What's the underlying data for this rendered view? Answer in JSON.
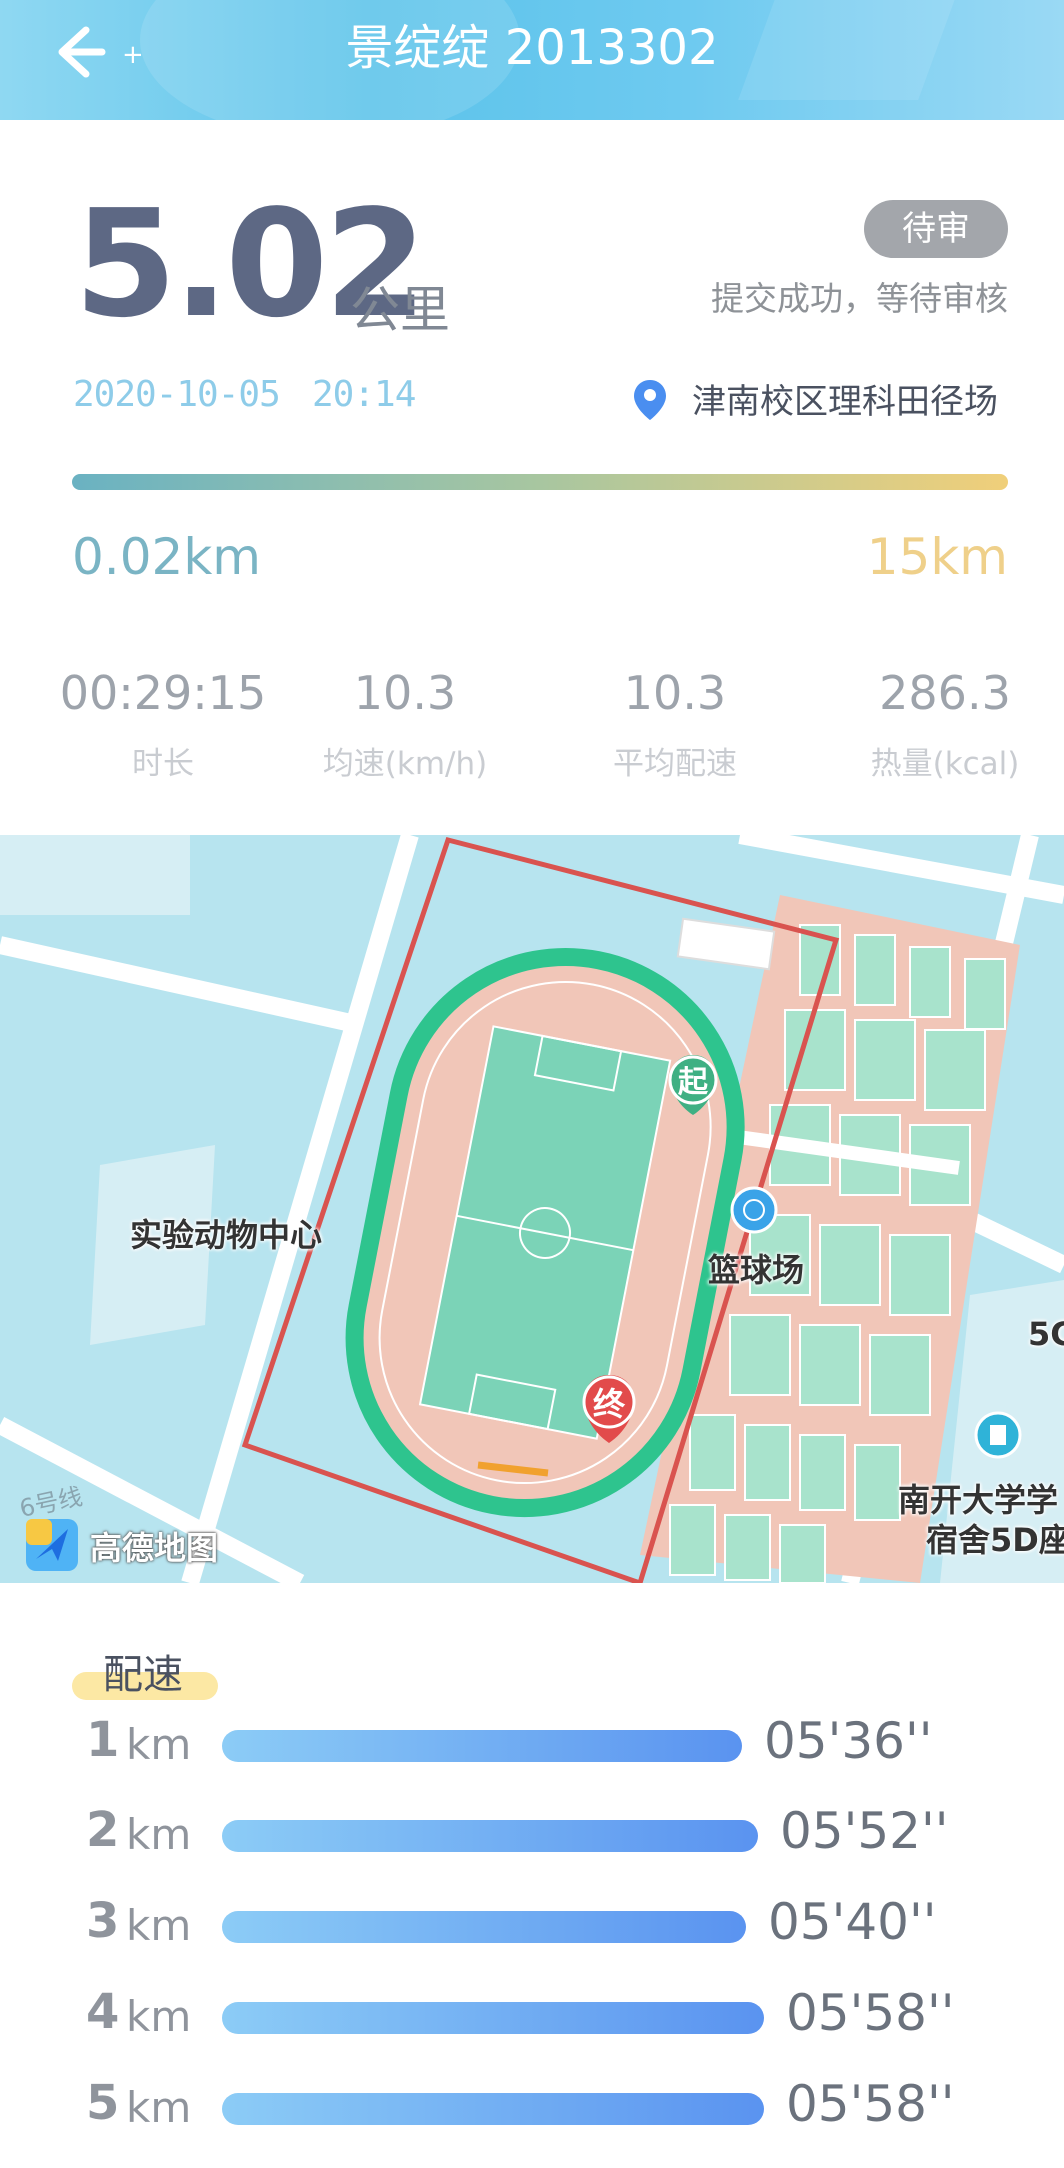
{
  "header": {
    "title": "景绽绽 2013302",
    "back_icon": "arrow-left-icon",
    "background_color": "#5cc3ea"
  },
  "summary": {
    "distance": "5.02",
    "distance_unit": "公里",
    "status_badge": "待审",
    "status_text": "提交成功，等待审核",
    "date": "2020-10-05",
    "time": "20:14",
    "location_icon": "location-pin-icon",
    "location": "津南校区理科田径场",
    "range_min": "0.02km",
    "range_max": "15km",
    "distance_progress_fraction": 0.33
  },
  "stats": [
    {
      "value": "00:29:15",
      "label": "时长"
    },
    {
      "value": "10.3",
      "label": "均速(km/h)"
    },
    {
      "value": "10.3",
      "label": "平均配速"
    },
    {
      "value": "286.3",
      "label": "热量(kcal)"
    }
  ],
  "map": {
    "start_marker": "起",
    "end_marker": "终",
    "pois": {
      "lab": "实验动物中心",
      "court": "篮球场",
      "dorm_line1": "南开大学学",
      "dorm_line2": "宿舍5D座",
      "partial": "5C"
    },
    "road_label": "6号线",
    "provider": "高德地图",
    "route_color": "#2ec48e",
    "boundary_color": "#d9534f"
  },
  "pace": {
    "title": "配速",
    "rows": [
      {
        "km": "1",
        "unit": "km",
        "pace": "05'36''"
      },
      {
        "km": "2",
        "unit": "km",
        "pace": "05'52''"
      },
      {
        "km": "3",
        "unit": "km",
        "pace": "05'40''"
      },
      {
        "km": "4",
        "unit": "km",
        "pace": "05'58''"
      },
      {
        "km": "5",
        "unit": "km",
        "pace": "05'58''"
      }
    ]
  }
}
